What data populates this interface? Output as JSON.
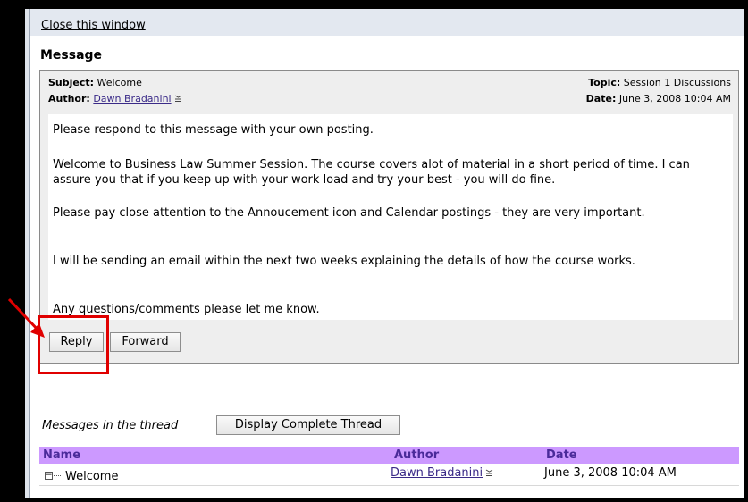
{
  "header": {
    "close_link": "Close this window"
  },
  "message": {
    "heading": "Message",
    "subject_label": "Subject:",
    "subject_value": "Welcome",
    "author_label": "Author:",
    "author_value": "Dawn Bradanini",
    "topic_label": "Topic:",
    "topic_value": "Session 1 Discussions",
    "date_label": "Date:",
    "date_value": "June 3, 2008 10:04 AM",
    "paragraphs": [
      "Please respond to this message with your own posting.",
      "Welcome to Business Law Summer Session. The course covers alot of material in a short period of time. I can assure you that if you keep up with your work load and try your best - you will do fine.",
      "Please pay close attention to the Annoucement icon and Calendar postings - they are very important.",
      "I will be sending an email within the next two weeks explaining the details of how the course works.",
      "Any questions/comments please let me know."
    ],
    "reply_button": "Reply",
    "forward_button": "Forward"
  },
  "thread": {
    "label": "Messages in the thread",
    "display_button": "Display Complete Thread",
    "columns": [
      "Name",
      "Author",
      "Date"
    ],
    "rows": [
      {
        "name": "Welcome",
        "author": "Dawn Bradanini",
        "date": "June 3, 2008 10:04 AM"
      }
    ]
  },
  "colors": {
    "table_header_bg": "#cc99ff",
    "highlight_red": "#e00000",
    "link_color": "#3a2a88"
  }
}
